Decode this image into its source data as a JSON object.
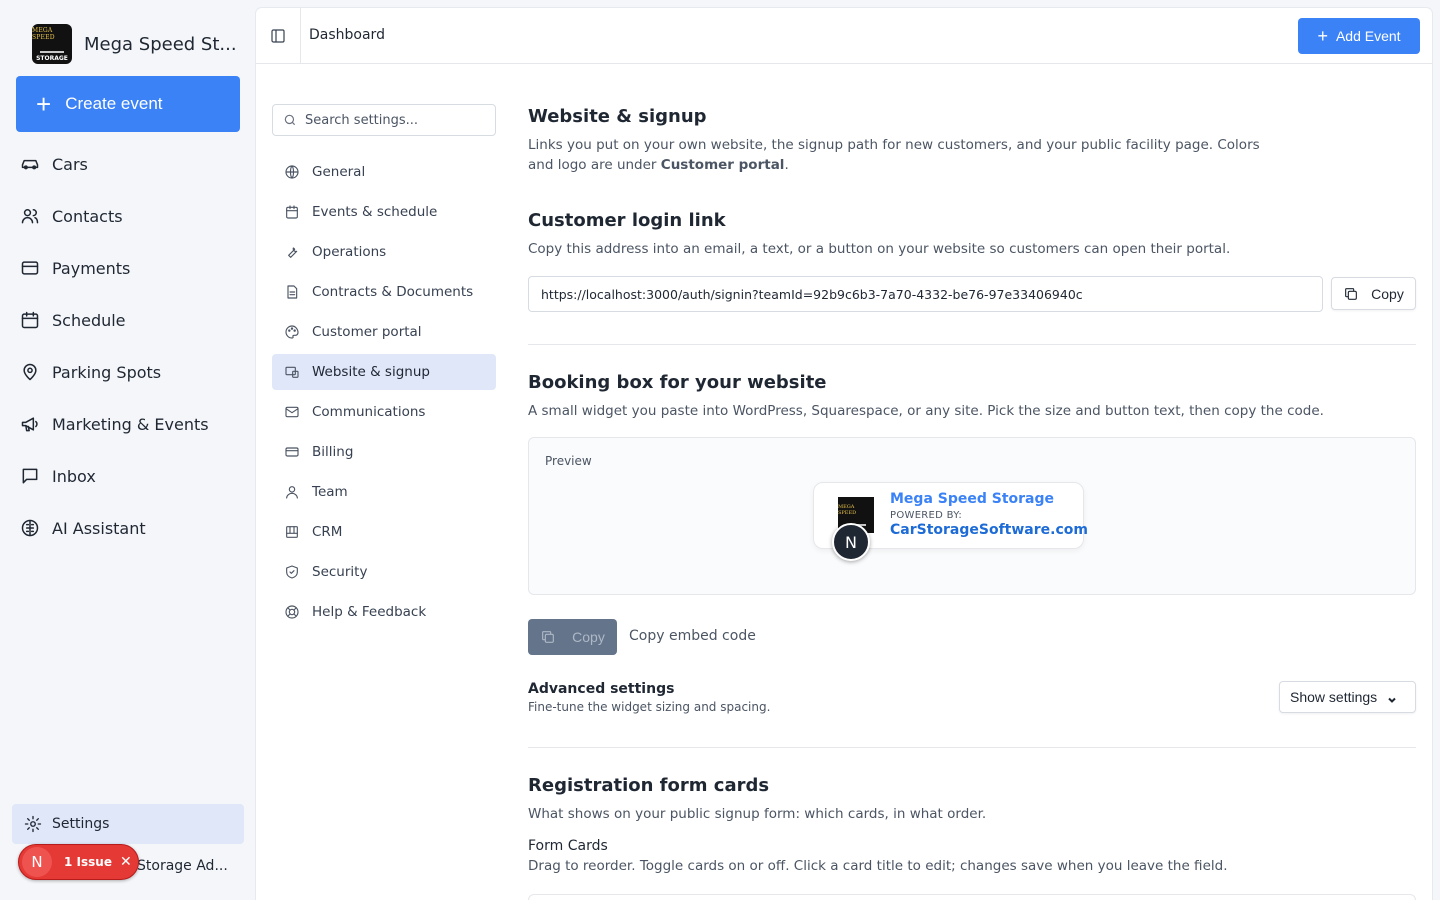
{
  "sidebar": {
    "brand_name": "Mega Speed St...",
    "logo_text_top": "MEGA SPEED",
    "logo_text_bottom": "STORAGE",
    "create_label": "Create event",
    "items": [
      {
        "label": "Cars",
        "icon": "car-icon"
      },
      {
        "label": "Contacts",
        "icon": "users-icon"
      },
      {
        "label": "Payments",
        "icon": "credit-card-icon"
      },
      {
        "label": "Schedule",
        "icon": "calendar-icon"
      },
      {
        "label": "Parking Spots",
        "icon": "map-pin-icon"
      },
      {
        "label": "Marketing & Events",
        "icon": "megaphone-icon"
      },
      {
        "label": "Inbox",
        "icon": "message-square-icon"
      },
      {
        "label": "AI Assistant",
        "icon": "brain-icon"
      }
    ],
    "settings_label": "Settings",
    "user_label": "Storage Ad...",
    "issue_avatar": "N",
    "issue_label": "1 Issue",
    "issue_close": "✕"
  },
  "topbar": {
    "breadcrumb": "Dashboard",
    "add_event_label": "Add Event"
  },
  "settings_nav": {
    "search_placeholder": "Search settings...",
    "items": [
      {
        "label": "General",
        "icon": "globe-icon"
      },
      {
        "label": "Events & schedule",
        "icon": "calendar-icon"
      },
      {
        "label": "Operations",
        "icon": "wrench-icon"
      },
      {
        "label": "Contracts & Documents",
        "icon": "file-text-icon"
      },
      {
        "label": "Customer portal",
        "icon": "palette-icon"
      },
      {
        "label": "Website & signup",
        "icon": "layout-icon",
        "active": true
      },
      {
        "label": "Communications",
        "icon": "mail-icon"
      },
      {
        "label": "Billing",
        "icon": "credit-card-icon"
      },
      {
        "label": "Team",
        "icon": "user-icon"
      },
      {
        "label": "CRM",
        "icon": "columns-icon"
      },
      {
        "label": "Security",
        "icon": "shield-icon"
      },
      {
        "label": "Help & Feedback",
        "icon": "life-buoy-icon"
      }
    ]
  },
  "content": {
    "website_title": "Website & signup",
    "website_desc_prefix": "Links you put on your own website, the signup path for new customers, and your public facility page. Colors and logo are under ",
    "website_desc_link": "Customer portal",
    "website_desc_suffix": ".",
    "login_title": "Customer login link",
    "login_desc": "Copy this address into an email, a text, or a button on your website so customers can open their portal.",
    "login_url": "https://localhost:3000/auth/signin?teamId=92b9c6b3-7a70-4332-be76-97e33406940c",
    "copy_label": "Copy",
    "booking_title": "Booking box for your website",
    "booking_desc": "A small widget you paste into WordPress, Squarespace, or any site. Pick the size and button text, then copy the code.",
    "preview_label": "Preview",
    "widget_name": "Mega Speed Storage",
    "widget_powered": "POWERED BY:",
    "widget_site": "CarStorageSoftware.com",
    "widget_avatar": "N",
    "embed_copy_label": "Copy",
    "embed_label": "Copy embed code",
    "advanced_title": "Advanced settings",
    "advanced_desc": "Fine-tune the widget sizing and spacing.",
    "show_settings_label": "Show settings",
    "registration_title": "Registration form cards",
    "registration_desc": "What shows on your public signup form: which cards, in what order.",
    "form_cards_title": "Form Cards",
    "form_cards_desc": "Drag to reorder. Toggle cards on or off. Click a card title to edit; changes save when you leave the field."
  },
  "colors": {
    "accent": "#3b82f6",
    "active_bg": "#dfe7f8",
    "issue_red": "#e53935"
  }
}
